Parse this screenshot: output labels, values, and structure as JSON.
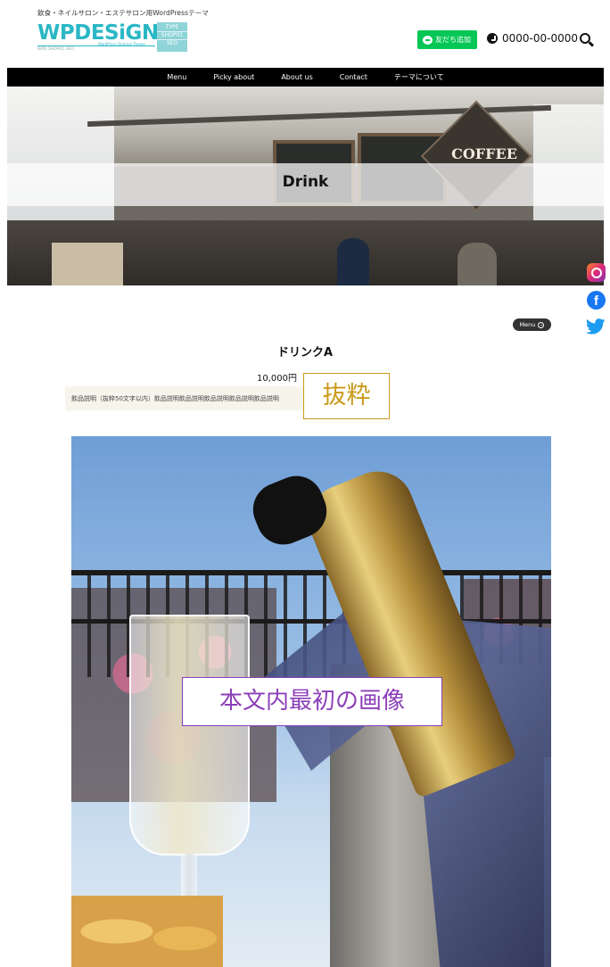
{
  "header": {
    "tagline": "飲食・ネイルサロン・エステサロン用WordPressテーマ",
    "logo_text": "WPDESiGN",
    "logo_type_lines": [
      "TYPE",
      "SHOP01",
      "SEO"
    ],
    "logo_sub": "WPD SHOP01 SEO",
    "logo_sub2": "WordPress Original Theme",
    "line_button_label": "友だち追加",
    "phone": "0000-00-0000"
  },
  "nav": {
    "items": [
      "Menu",
      "Picky about",
      "About us",
      "Contact",
      "テーマについて"
    ]
  },
  "hero": {
    "title": "Drink",
    "sign_text": "COFFEE"
  },
  "floating": {
    "menu_label": "Menu",
    "menu_icon": "chevron-circle-icon"
  },
  "social": [
    "instagram-icon",
    "facebook-icon",
    "twitter-icon"
  ],
  "product": {
    "title": "ドリンクA",
    "price": "10,000円",
    "excerpt_text": "飲品説明（抜粋50文字以内）飲品説明飲品説明飲品説明飲品説明飲品説明",
    "excerpt_label": "抜粋",
    "body_image_label": "本文内最初の画像"
  },
  "colors": {
    "brand": "#2bb7c4",
    "line_green": "#06c755",
    "nav_bg": "#000000",
    "excerpt_label": "#c99a1b",
    "body_image_label": "#8b3fb8"
  }
}
